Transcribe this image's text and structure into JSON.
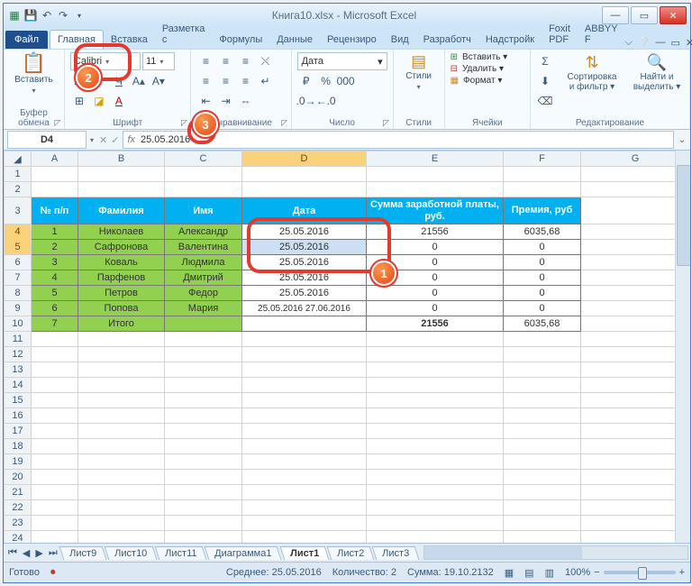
{
  "title": "Книга10.xlsx - Microsoft Excel",
  "qat": {
    "save": "💾",
    "undo": "↶",
    "redo": "↷",
    "down": "▾"
  },
  "tabs": {
    "file": "Файл",
    "home": "Главная",
    "insert": "Вставка",
    "layout": "Разметка с",
    "formulas": "Формулы",
    "data": "Данные",
    "review": "Рецензиро",
    "view": "Вид",
    "dev": "Разработч",
    "addins": "Надстройк",
    "foxit": "Foxit PDF",
    "abbyy": "ABBYY F"
  },
  "ribbon": {
    "clipboard": {
      "paste": "Вставить",
      "label": "Буфер обмена"
    },
    "font": {
      "name": "Calibri",
      "size": "11",
      "label": "Шрифт"
    },
    "align": {
      "label": "Выравнивание"
    },
    "number": {
      "format": "Дата",
      "label": "Число"
    },
    "styles": {
      "label": "Стили",
      "btn": "Стили"
    },
    "cells": {
      "insert": "Вставить ▾",
      "delete": "Удалить ▾",
      "format": "Формат ▾",
      "label": "Ячейки"
    },
    "editing": {
      "sort": "Сортировка и фильтр ▾",
      "find": "Найти и выделить ▾",
      "label": "Редактирование"
    }
  },
  "namebox": "D4",
  "formula": "25.05.2016",
  "cols": [
    "A",
    "B",
    "C",
    "D",
    "E",
    "F",
    "G"
  ],
  "rows": [
    "1",
    "2",
    "3",
    "4",
    "5",
    "6",
    "7",
    "8",
    "9",
    "10",
    "11",
    "12",
    "13",
    "14",
    "15",
    "16",
    "17",
    "18",
    "19",
    "20",
    "21",
    "22",
    "23",
    "24"
  ],
  "hdr": {
    "num": "№ п/п",
    "fam": "Фамилия",
    "name": "Имя",
    "date": "Дата",
    "sum": "Сумма заработной платы, руб.",
    "bonus": "Премия, руб"
  },
  "data": [
    {
      "n": "1",
      "f": "Николаев",
      "i": "Александр",
      "d": "25.05.2016",
      "s": "21556",
      "p": "6035,68"
    },
    {
      "n": "2",
      "f": "Сафронова",
      "i": "Валентина",
      "d": "25.05.2016",
      "s": "0",
      "p": "0"
    },
    {
      "n": "3",
      "f": "Коваль",
      "i": "Людмила",
      "d": "25.05.2016",
      "s": "0",
      "p": "0"
    },
    {
      "n": "4",
      "f": "Парфенов",
      "i": "Дмитрий",
      "d": "25.05.2016",
      "s": "0",
      "p": "0"
    },
    {
      "n": "5",
      "f": "Петров",
      "i": "Федор",
      "d": "25.05.2016",
      "s": "0",
      "p": "0"
    },
    {
      "n": "6",
      "f": "Попова",
      "i": "Мария",
      "d": "25.05.2016 27.06.2016",
      "s": "0",
      "p": "0"
    },
    {
      "n": "7",
      "f": "Итого",
      "i": "",
      "d": "",
      "s": "21556",
      "p": "6035,68"
    }
  ],
  "sheets": {
    "nav": "◄◄ ◄ ► ►►",
    "s1": "Лист9",
    "s2": "Лист10",
    "s3": "Лист11",
    "s4": "Диаграмма1",
    "active": "Лист1",
    "s5": "Лист2",
    "s6": "Лист3"
  },
  "status": {
    "ready": "Готово",
    "avg": "Среднее: 25.05.2016",
    "count": "Количество: 2",
    "sum": "Сумма: 19.10.2132",
    "zoom": "100%"
  },
  "chart_data": {
    "type": "table",
    "title": "Книга10.xlsx / Лист1",
    "columns": [
      "№ п/п",
      "Фамилия",
      "Имя",
      "Дата",
      "Сумма заработной платы, руб.",
      "Премия, руб"
    ],
    "rows": [
      [
        1,
        "Николаев",
        "Александр",
        "25.05.2016",
        21556,
        6035.68
      ],
      [
        2,
        "Сафронова",
        "Валентина",
        "25.05.2016",
        0,
        0
      ],
      [
        3,
        "Коваль",
        "Людмила",
        "25.05.2016",
        0,
        0
      ],
      [
        4,
        "Парфенов",
        "Дмитрий",
        "25.05.2016",
        0,
        0
      ],
      [
        5,
        "Петров",
        "Федор",
        "25.05.2016",
        0,
        0
      ],
      [
        6,
        "Попова",
        "Мария",
        "25.05.2016 27.06.2016",
        0,
        0
      ],
      [
        7,
        "Итого",
        "",
        "",
        21556,
        6035.68
      ]
    ]
  }
}
